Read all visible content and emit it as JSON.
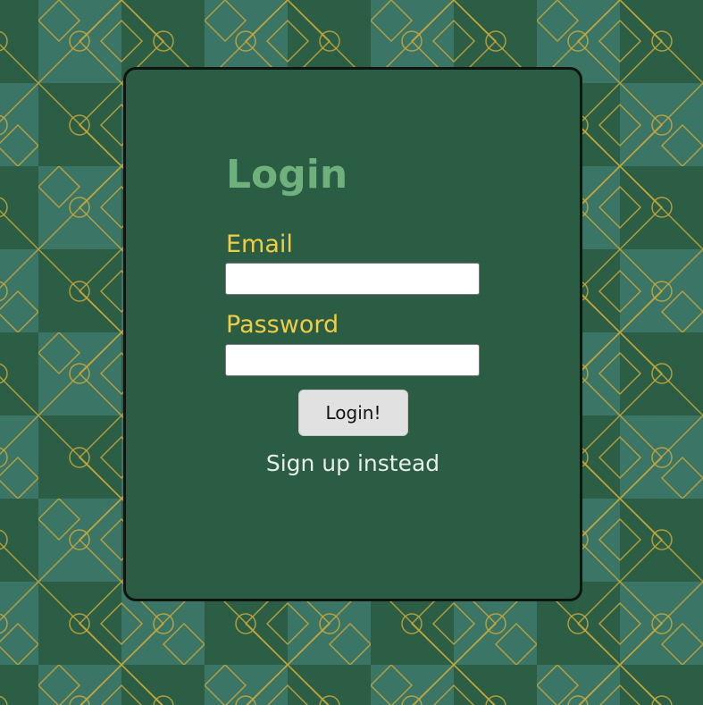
{
  "login": {
    "title": "Login",
    "email_label": "Email",
    "email_value": "",
    "password_label": "Password",
    "password_value": "",
    "submit_label": "Login!",
    "signup_link": "Sign up instead"
  },
  "colors": {
    "background_dark": "#2b5e44",
    "background_light": "#3a7565",
    "pattern_stroke": "#c9a83a",
    "card_bg": "#2a5d43",
    "title": "#6fb17c",
    "label": "#f0cd45",
    "link": "#e8ede8"
  },
  "icons": {
    "background": "geometric-diamond-circle-pattern"
  }
}
